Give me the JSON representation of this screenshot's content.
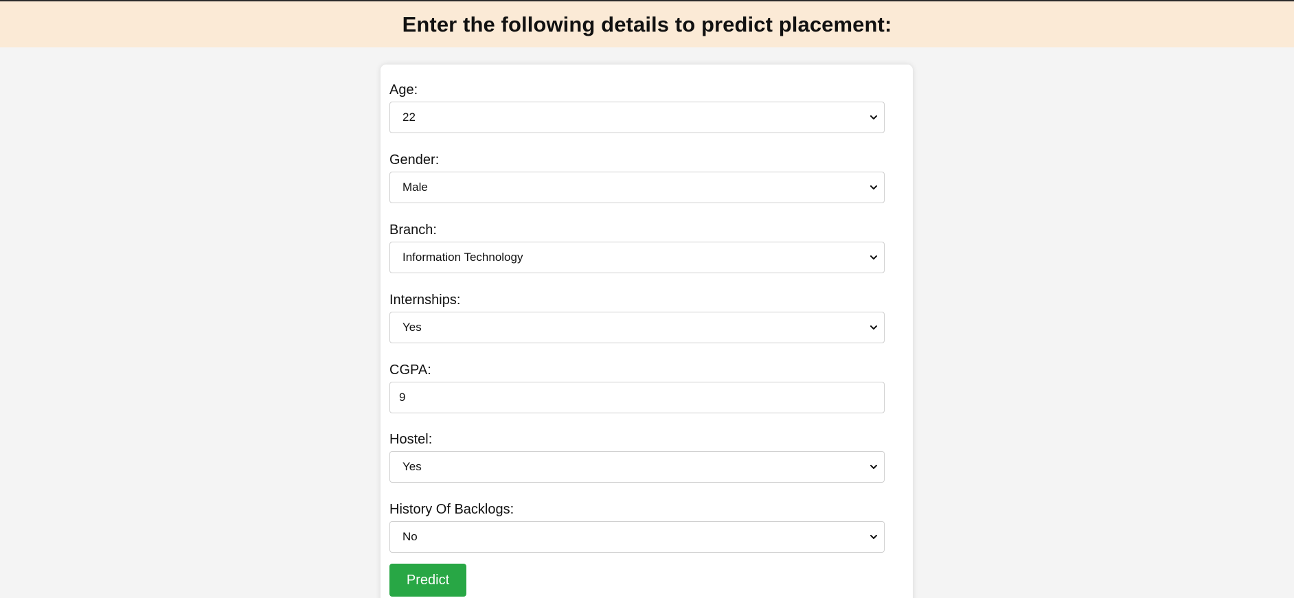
{
  "header": {
    "title": "Enter the following details to predict placement:"
  },
  "form": {
    "age": {
      "label": "Age:",
      "value": "22"
    },
    "gender": {
      "label": "Gender:",
      "value": "Male"
    },
    "branch": {
      "label": "Branch:",
      "value": "Information Technology"
    },
    "internships": {
      "label": "Internships:",
      "value": "Yes"
    },
    "cgpa": {
      "label": "CGPA:",
      "value": "9"
    },
    "hostel": {
      "label": "Hostel:",
      "value": "Yes"
    },
    "backlogs": {
      "label": "History Of Backlogs:",
      "value": "No"
    },
    "submit_label": "Predict"
  },
  "icons": {
    "dropdown": "chevron-down-icon"
  },
  "colors": {
    "header_bg": "#fbead6",
    "page_bg": "#f4f4f4",
    "button_bg": "#28a745",
    "button_text": "#ffffff"
  }
}
